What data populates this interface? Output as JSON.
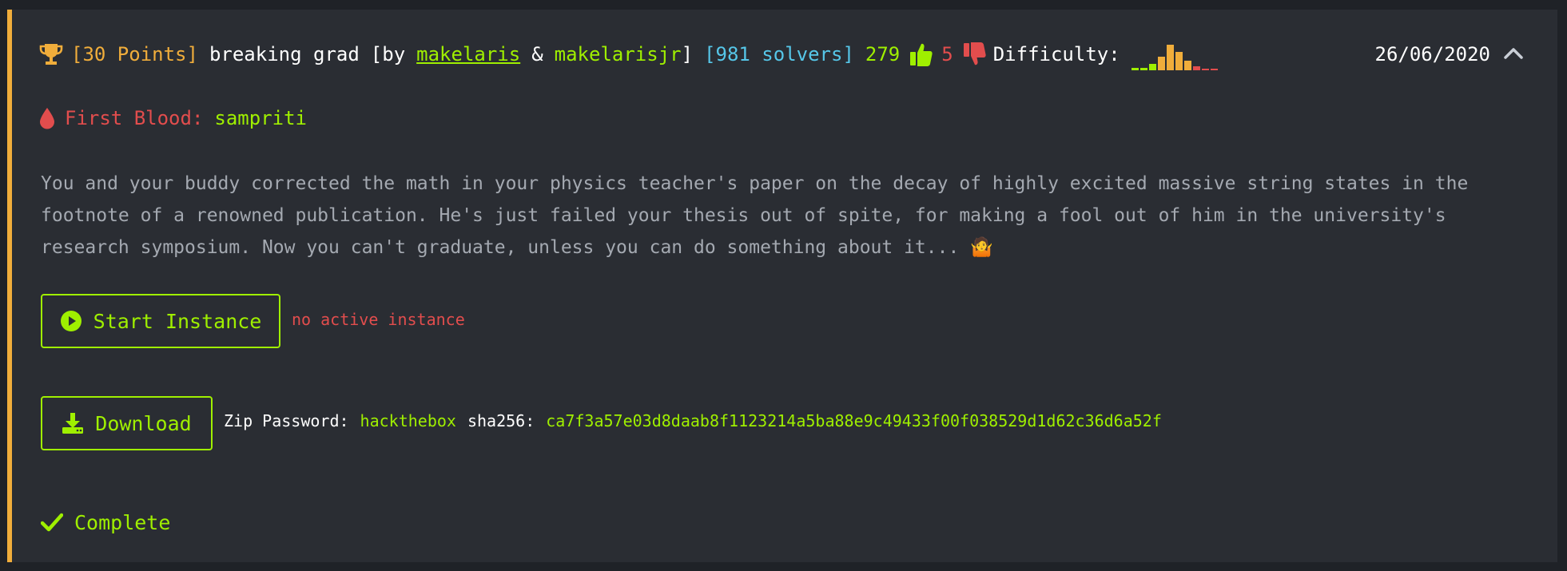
{
  "challenge": {
    "points": "[30 Points]",
    "name": "breaking grad",
    "by_prefix": "[by",
    "author1": "makelaris",
    "amp": "&",
    "author2": "makelarisjr",
    "by_suffix": "]",
    "solvers": "[981 solvers]",
    "likes": "279",
    "dislikes": "5",
    "difficulty_label": "Difficulty:",
    "difficulty_bars": [
      {
        "level": 0.08,
        "color": "#9fef00"
      },
      {
        "level": 0.08,
        "color": "#9fef00"
      },
      {
        "level": 0.2,
        "color": "#9fef00"
      },
      {
        "level": 0.45,
        "color": "#f0ad3b"
      },
      {
        "level": 0.85,
        "color": "#f0ad3b"
      },
      {
        "level": 0.6,
        "color": "#f0ad3b"
      },
      {
        "level": 0.32,
        "color": "#f0ad3b"
      },
      {
        "level": 0.12,
        "color": "#e24d4d"
      },
      {
        "level": 0.06,
        "color": "#e24d4d"
      },
      {
        "level": 0.06,
        "color": "#e24d4d"
      }
    ],
    "date": "26/06/2020"
  },
  "first_blood": {
    "label": "First Blood:",
    "user": "sampriti"
  },
  "description": "You and your buddy corrected the math in your physics teacher's paper on the decay of highly excited massive string states in the footnote of a renowned publication. He's just failed your thesis out of spite, for making a fool out of him in the university's research symposium. Now you can't graduate, unless you can do something about it... 🤷",
  "instance": {
    "start_label": "Start Instance",
    "status": "no active instance"
  },
  "download": {
    "label": "Download",
    "zip_label": "Zip Password:",
    "zip_password": "hackthebox",
    "sha_label": "sha256:",
    "sha256": "ca7f3a57e03d8daab8f1123214a5ba88e9c49433f00f038529d1d62c36d6a52f"
  },
  "status": {
    "complete_label": "Complete"
  },
  "icons": {
    "trophy": "trophy-icon",
    "like": "thumbs-up-icon",
    "dislike": "thumbs-down-icon",
    "collapse": "chevron-up-icon",
    "blood": "blood-drop-icon",
    "play": "play-circle-icon",
    "download": "download-icon",
    "check": "check-icon"
  },
  "colors": {
    "accent": "#f0ad3b",
    "green": "#9fef00",
    "red": "#e24d4d",
    "cyan": "#56c7e9"
  }
}
